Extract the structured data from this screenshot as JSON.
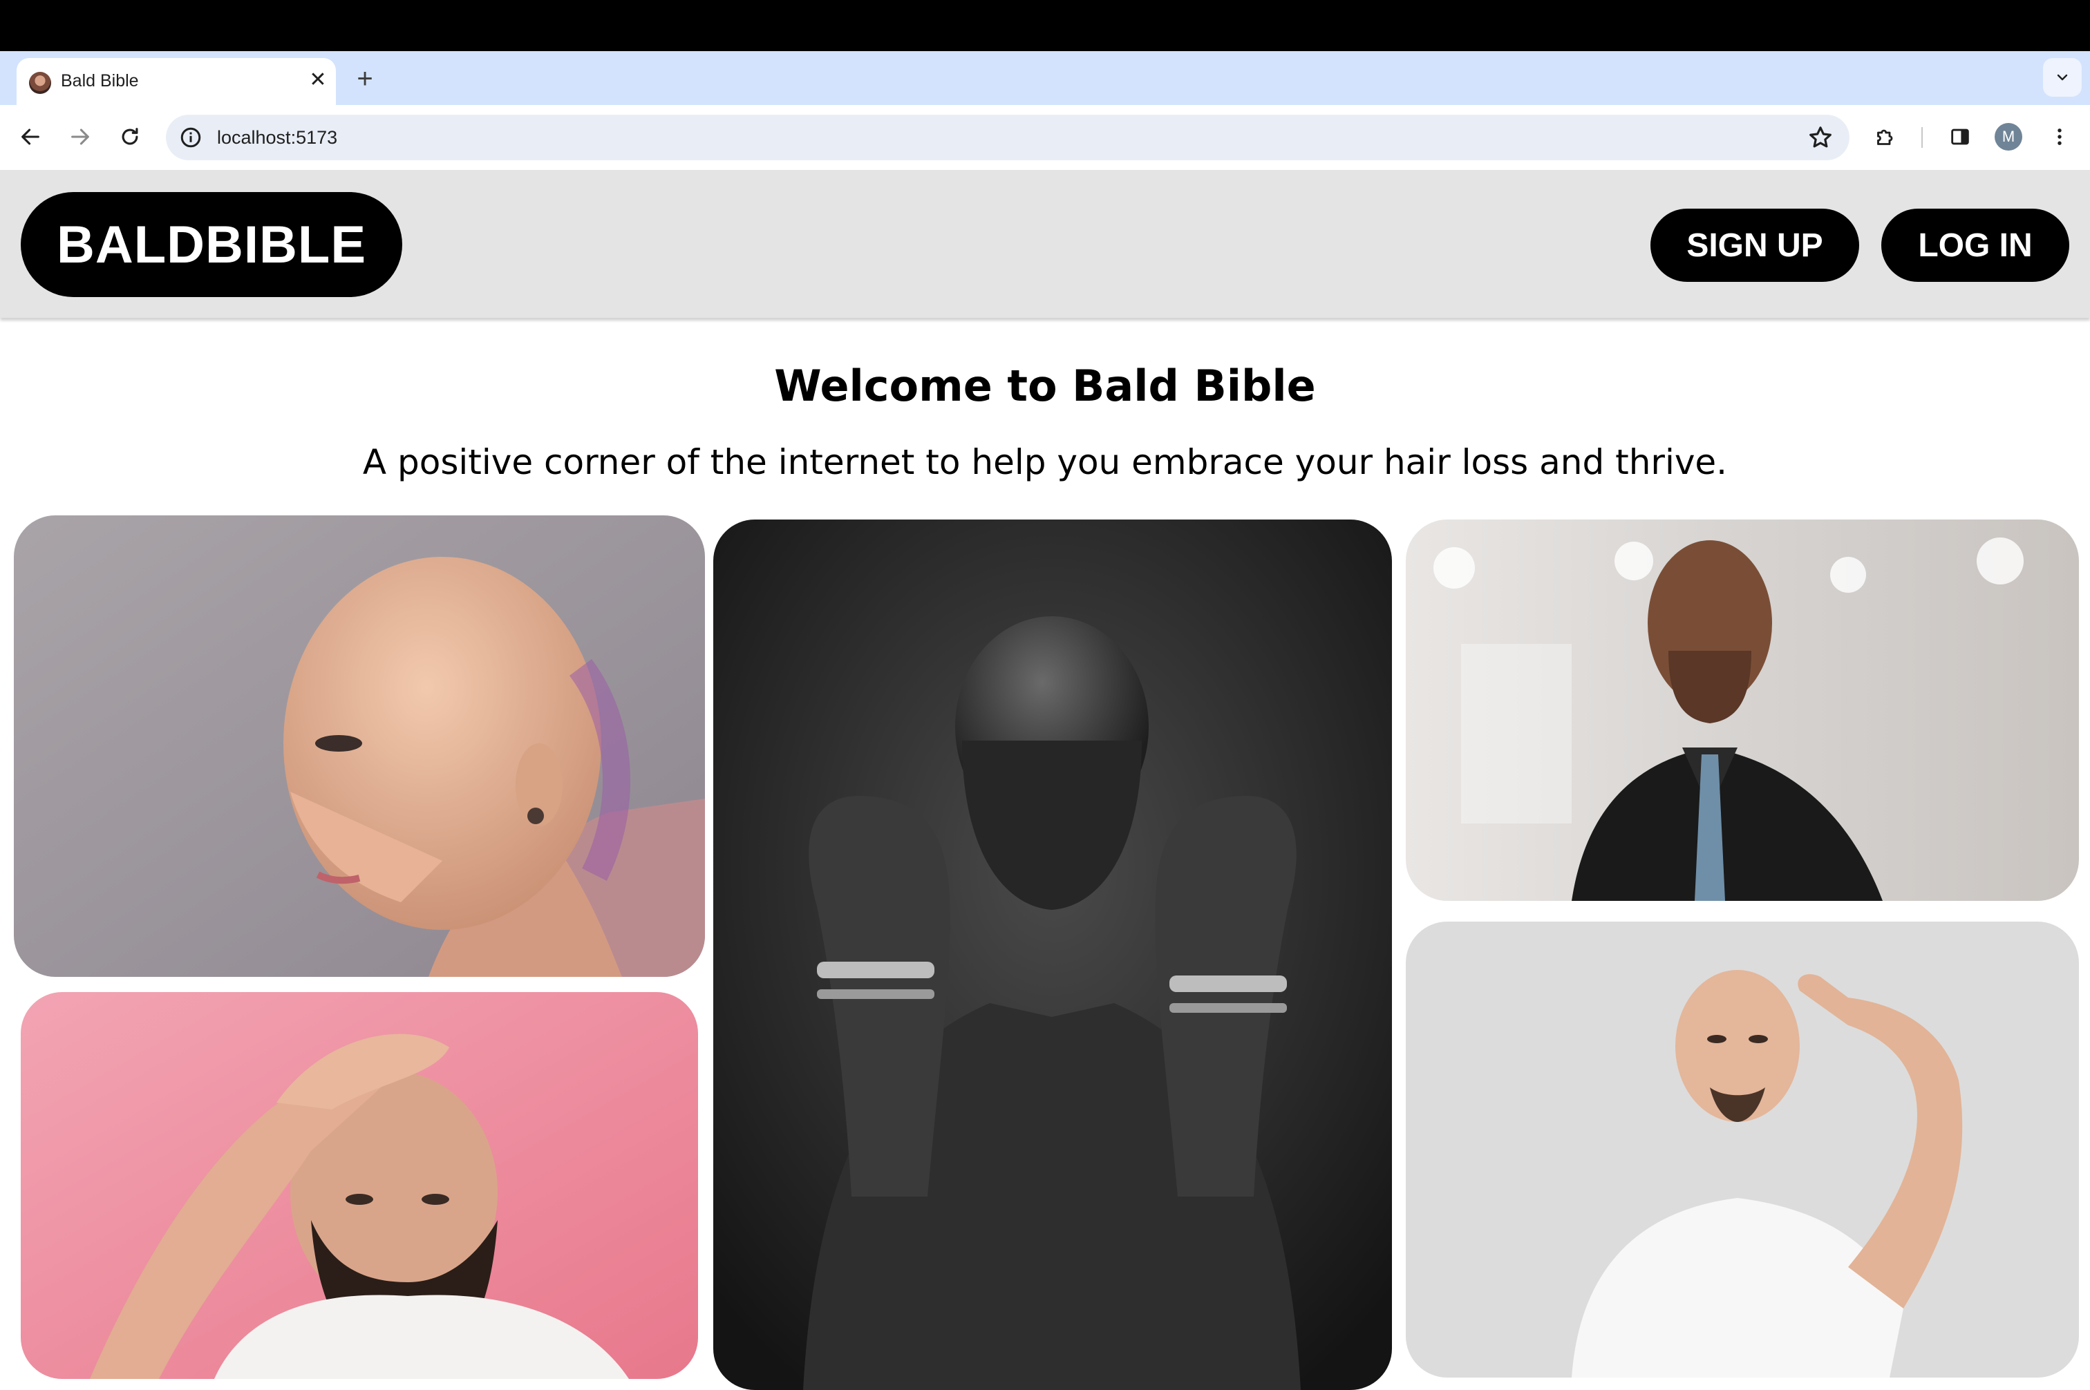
{
  "browser": {
    "tab_title": "Bald Bible",
    "tab_close": "✕",
    "new_tab": "+",
    "url": "localhost:5173",
    "profile_initial": "M"
  },
  "header": {
    "logo": "BALDBIBLE",
    "signup_label": "SIGN UP",
    "login_label": "LOG IN"
  },
  "hero": {
    "title": "Welcome to Bald Bible",
    "subtitle": "A positive corner of the internet to help you embrace your hair loss and thrive."
  },
  "colors": {
    "black": "#000000",
    "header_bg": "#e4e4e4",
    "tabstrip_bg": "#d3e3fd",
    "omnibox_bg": "#e9eef6"
  },
  "icons": [
    "back-arrow-icon",
    "forward-arrow-icon",
    "reload-icon",
    "site-info-icon",
    "bookmark-star-icon",
    "extensions-icon",
    "side-panel-icon",
    "more-vert-icon",
    "chevron-down-icon"
  ]
}
